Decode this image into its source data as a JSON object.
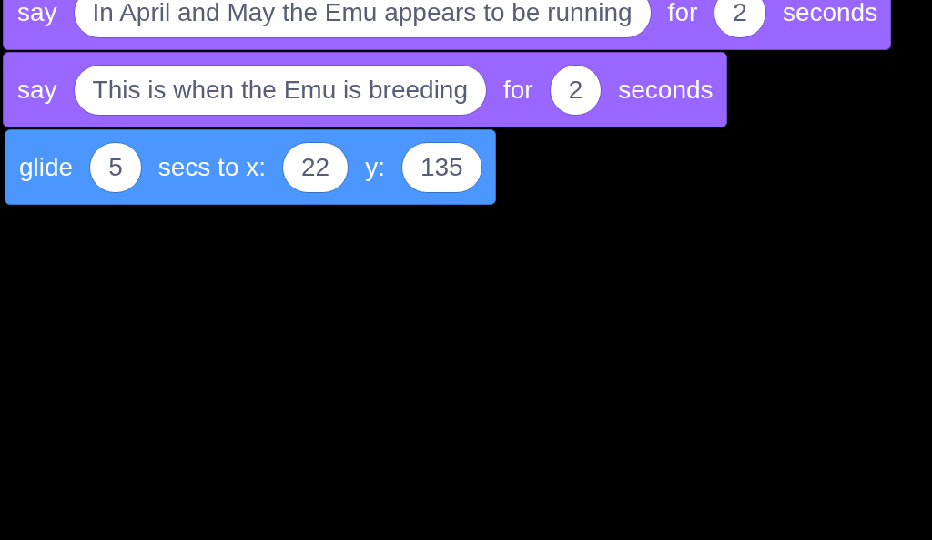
{
  "blocks": [
    {
      "kind": "looks",
      "parts": [
        {
          "kind": "label",
          "text": "say"
        },
        {
          "kind": "input",
          "text": "In April and May the Emu appears to be running"
        },
        {
          "kind": "label",
          "text": "for"
        },
        {
          "kind": "input",
          "text": "2"
        },
        {
          "kind": "label",
          "text": "seconds"
        }
      ]
    },
    {
      "kind": "looks",
      "parts": [
        {
          "kind": "label",
          "text": "say"
        },
        {
          "kind": "input",
          "text": "This is when the Emu is breeding"
        },
        {
          "kind": "label",
          "text": "for"
        },
        {
          "kind": "input",
          "text": "2"
        },
        {
          "kind": "label",
          "text": "seconds"
        }
      ]
    },
    {
      "kind": "motion",
      "parts": [
        {
          "kind": "label",
          "text": "glide"
        },
        {
          "kind": "input",
          "text": "5"
        },
        {
          "kind": "label",
          "text": "secs to x:"
        },
        {
          "kind": "input",
          "text": "22"
        },
        {
          "kind": "label",
          "text": "y:"
        },
        {
          "kind": "input",
          "text": "135"
        }
      ]
    }
  ]
}
